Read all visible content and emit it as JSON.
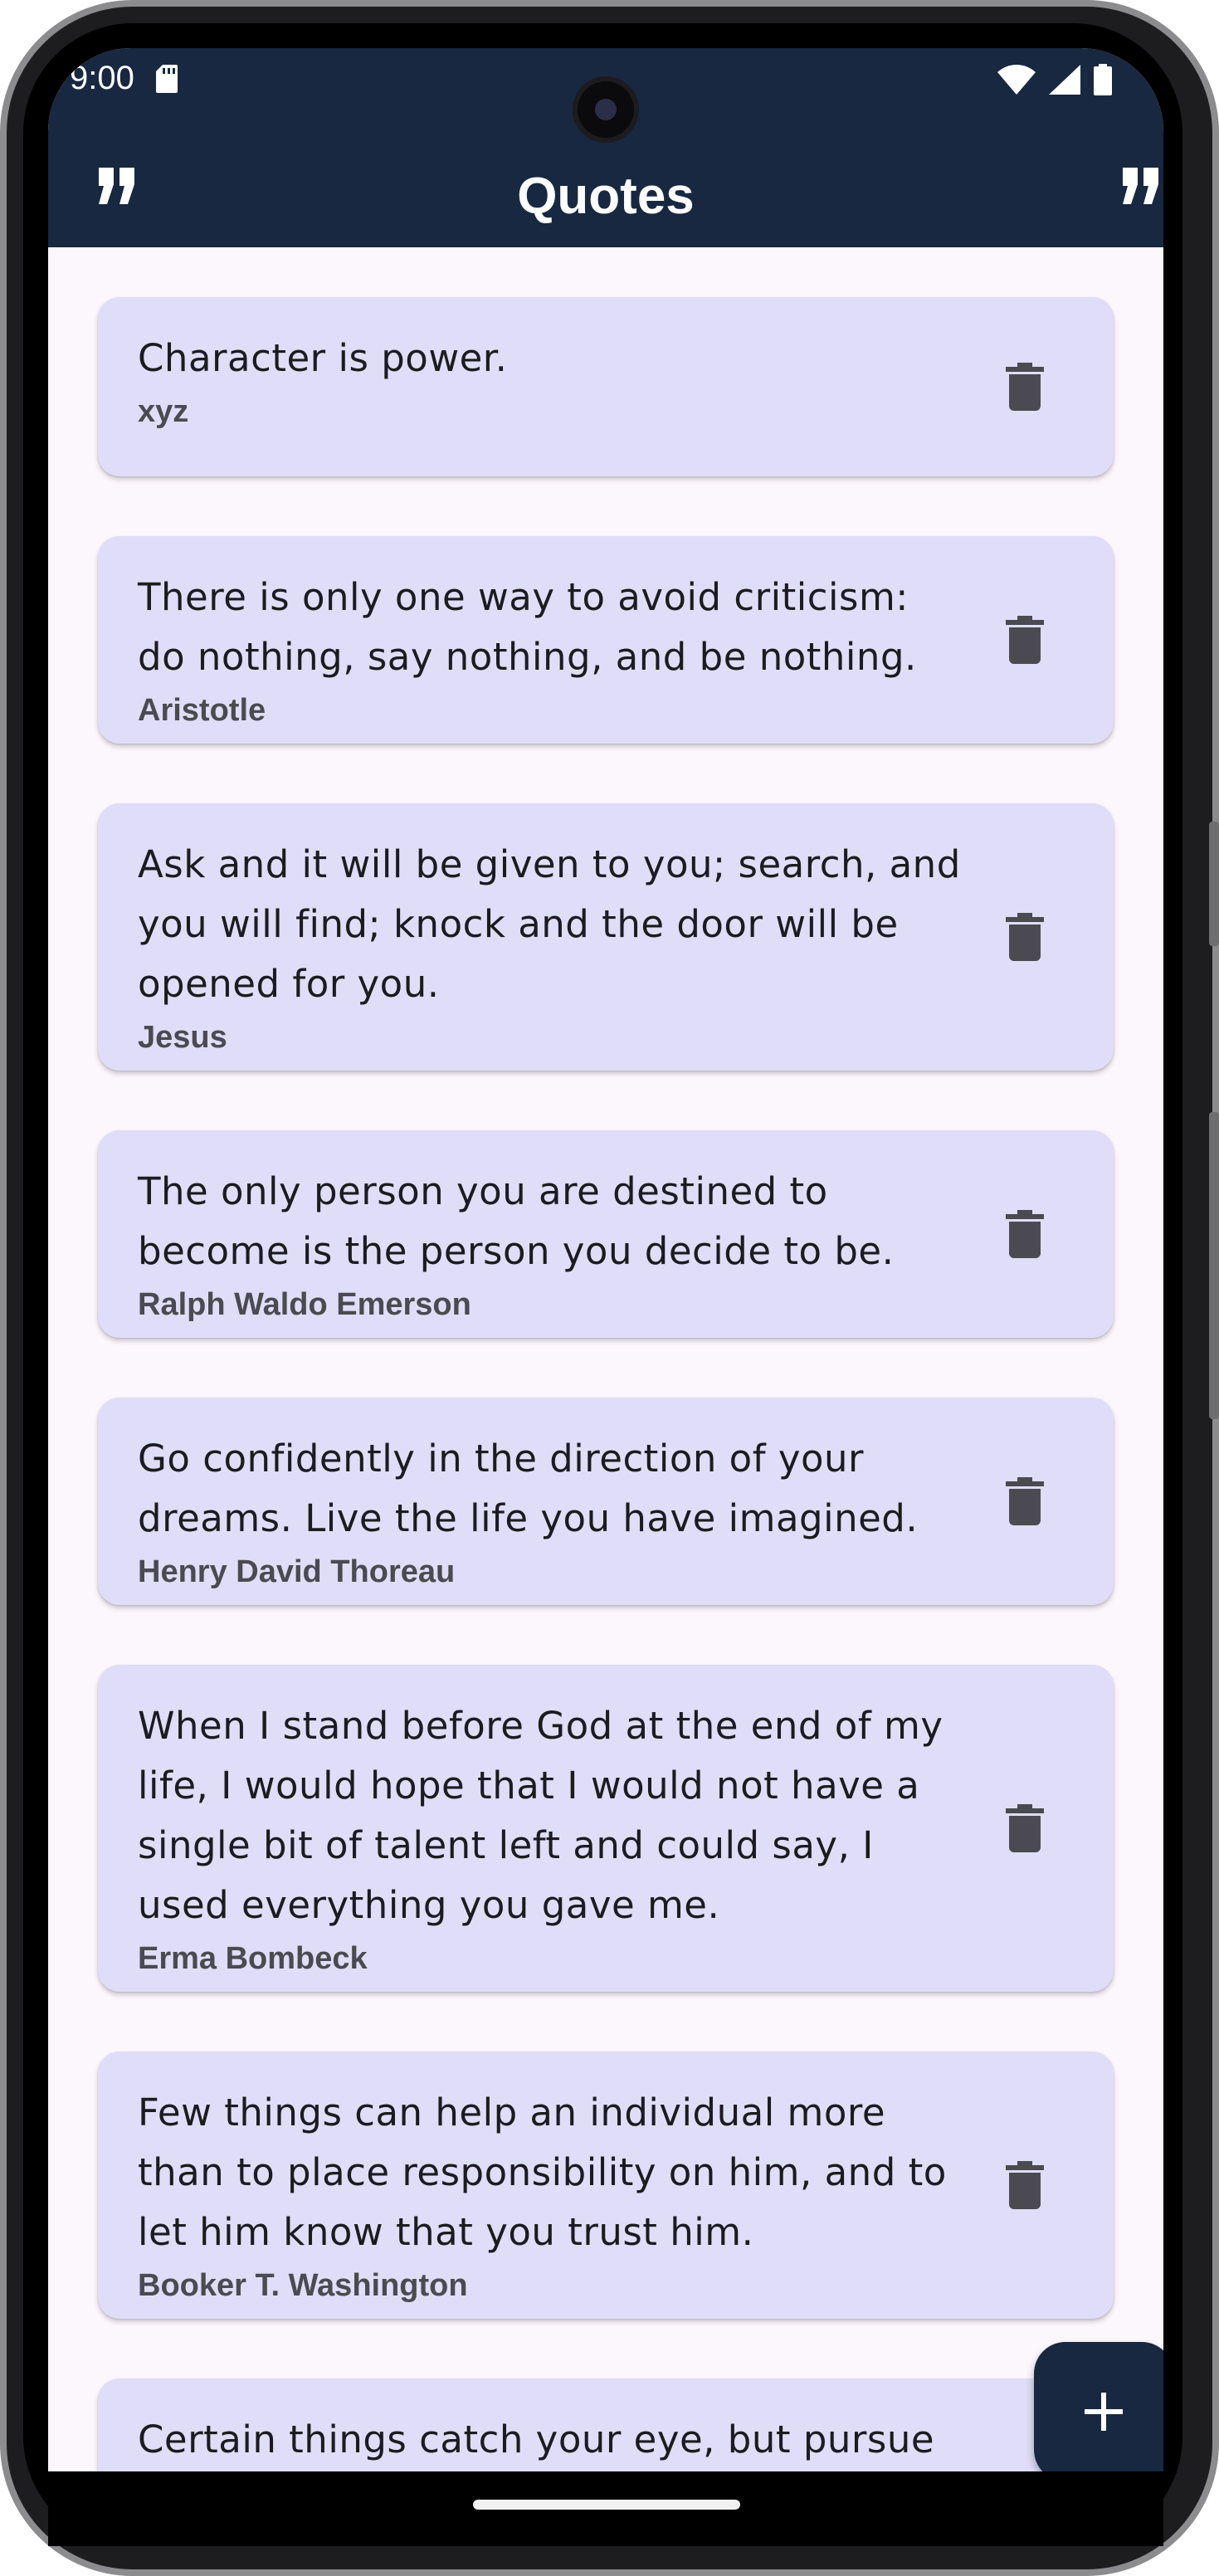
{
  "status_bar": {
    "time": "9:00"
  },
  "app_bar": {
    "title": "Quotes",
    "left_icon": "format-quote-icon",
    "right_icon": "format-quote-icon"
  },
  "quotes": [
    {
      "text": "Character is power.",
      "author": "xyz"
    },
    {
      "text": "There is only one way to avoid criticism: do nothing, say nothing, and be nothing.",
      "author": "Aristotle"
    },
    {
      "text": "Ask and it will be given to you; search, and you will find; knock and the door will be opened for you.",
      "author": "Jesus"
    },
    {
      "text": "The only person you are destined to become is the person you decide to be.",
      "author": "Ralph Waldo Emerson"
    },
    {
      "text": "Go confidently in the direction of your dreams.  Live the life you have imagined.",
      "author": "Henry David Thoreau"
    },
    {
      "text": "When I stand before God at the end of my life, I would hope that I would not have a single bit of talent left and could say, I used everything you gave me.",
      "author": "Erma Bombeck"
    },
    {
      "text": "Few things can help an individual more than to place responsibility on him, and to let him know that you trust him.",
      "author": "Booker T. Washington"
    },
    {
      "text": "Certain things catch your eye, but pursue",
      "author": ""
    }
  ],
  "fab": {
    "icon": "plus-icon"
  },
  "colors": {
    "app_bar": "#182840",
    "card": "#e0ddf9",
    "background": "#fcf6fd",
    "trash_icon": "#4a4a50"
  }
}
